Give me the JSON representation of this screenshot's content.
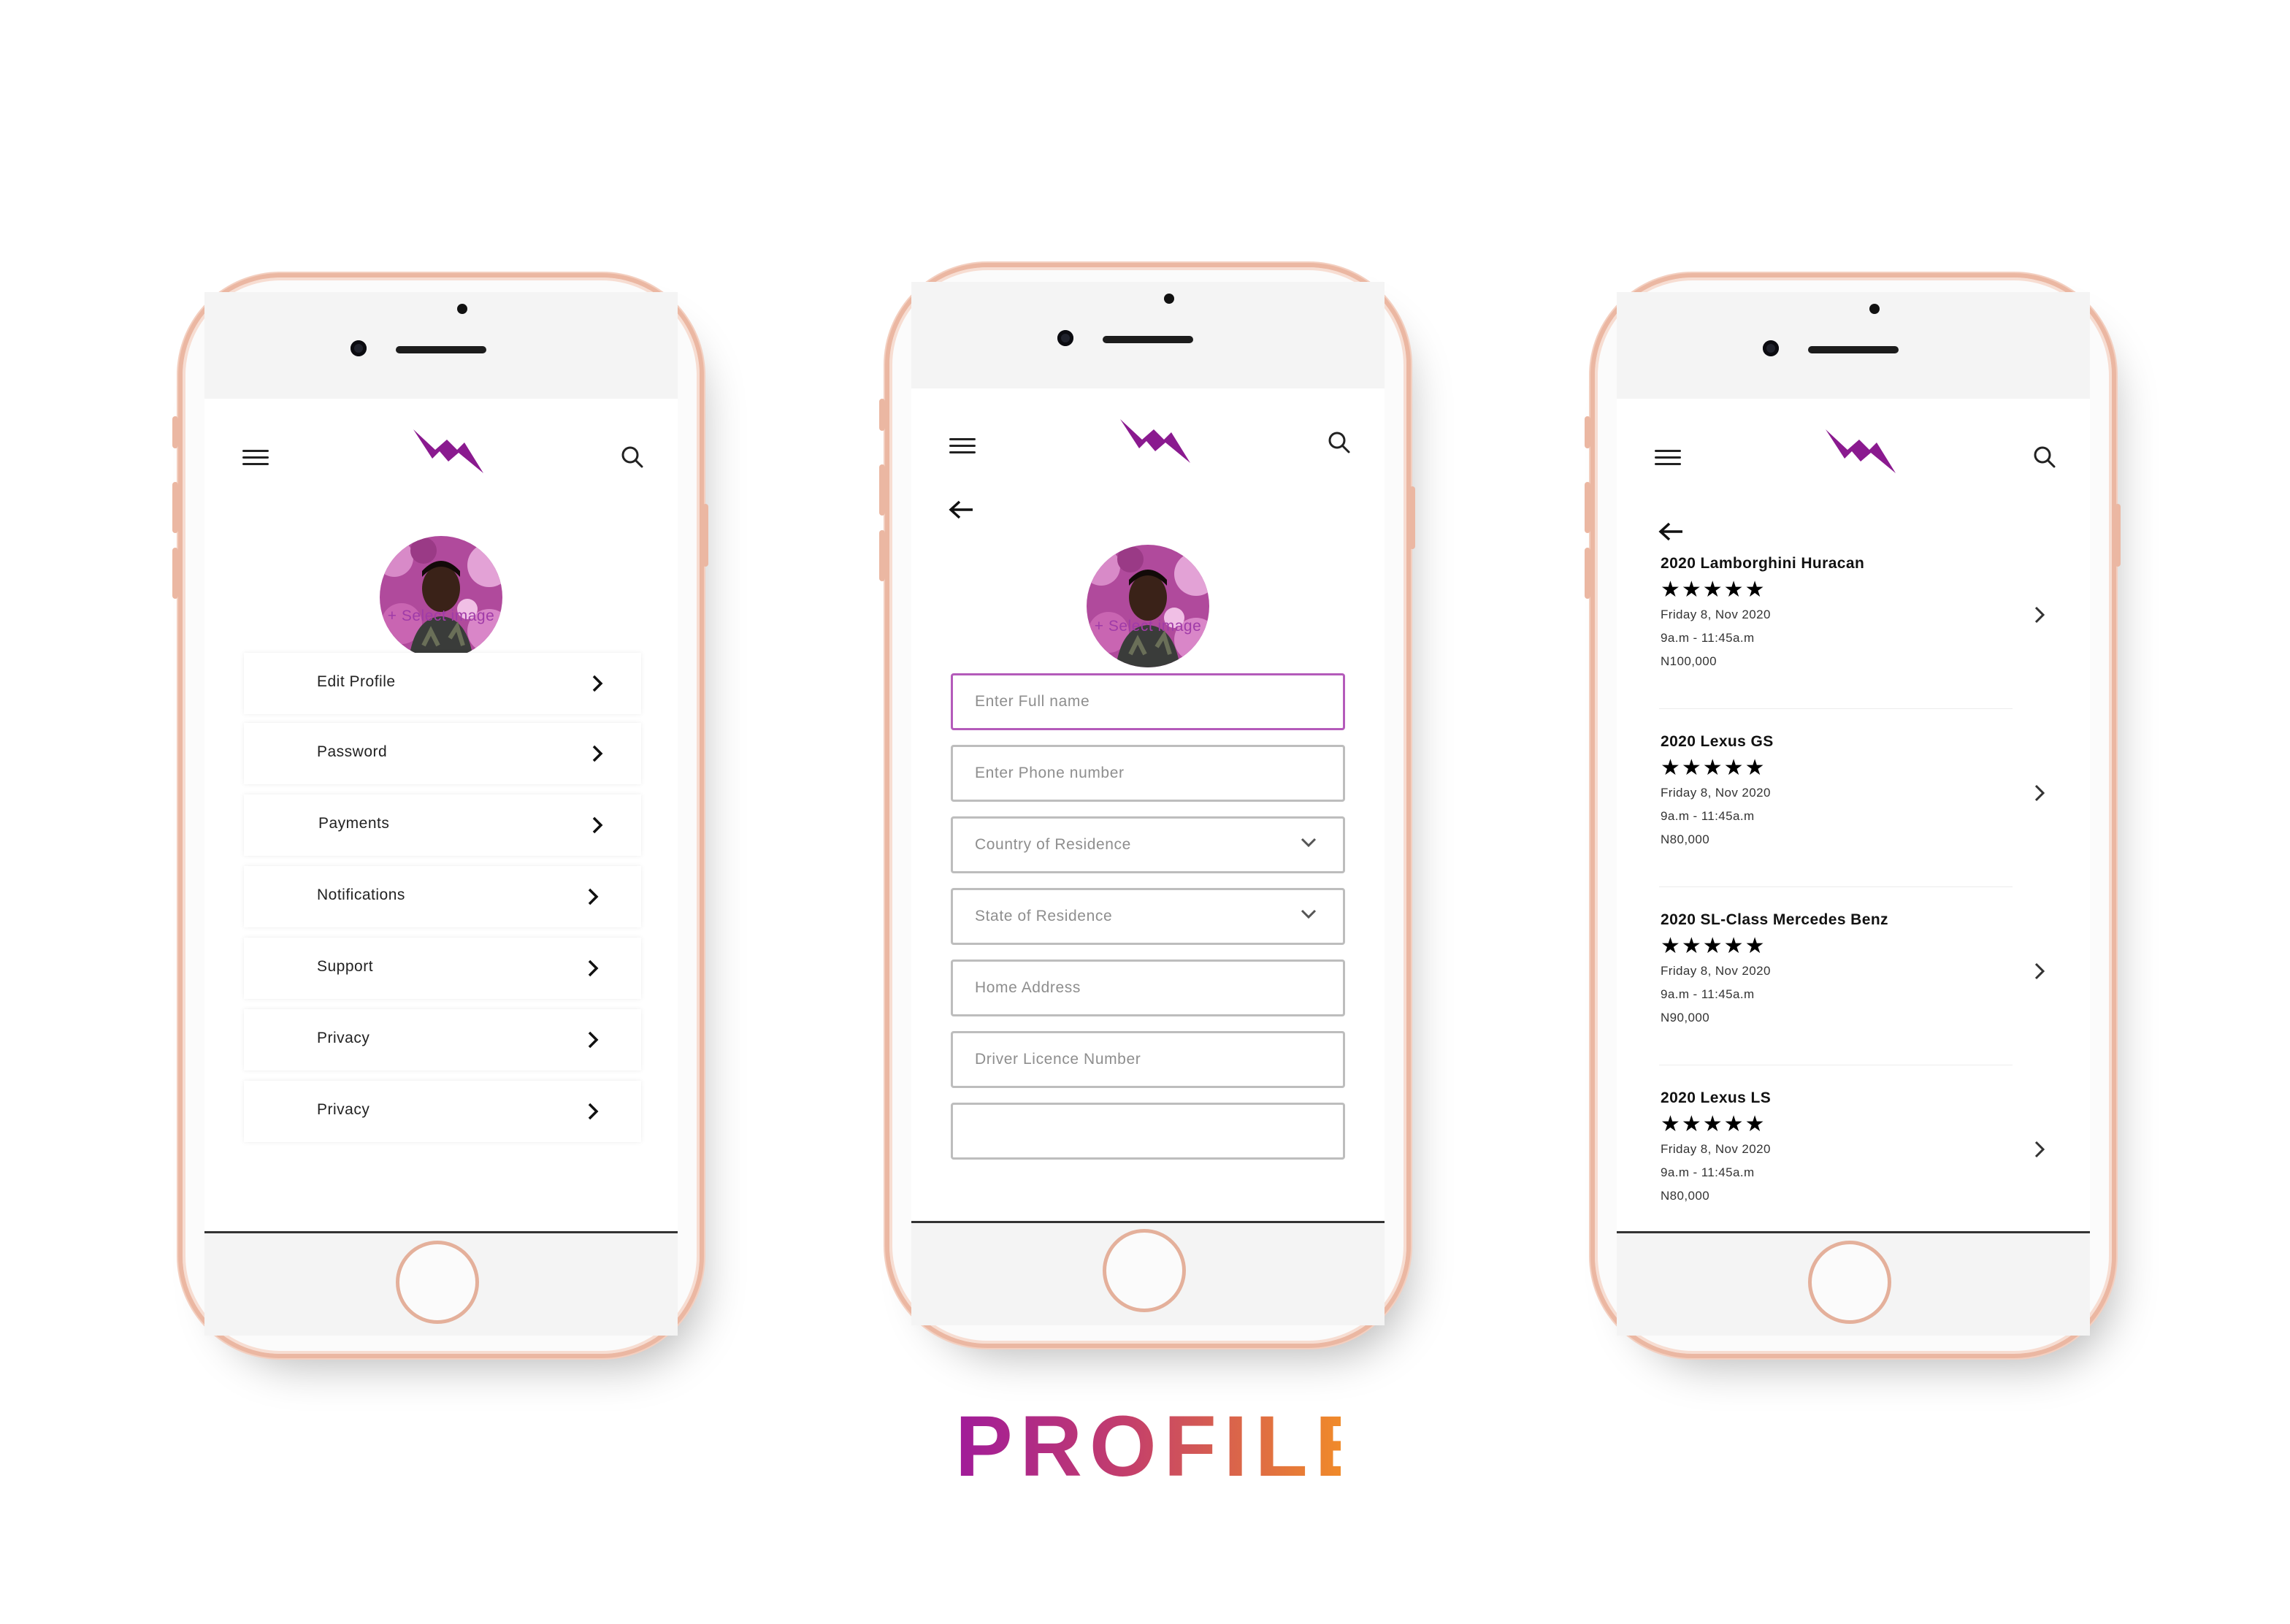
{
  "page_title": "PROFILE",
  "colors": {
    "brand_purple": "#8a1a8f",
    "accent_link": "#a03ba8",
    "title_gradient_start": "#a01b9a",
    "title_gradient_end": "#f08a2a"
  },
  "icons": [
    "hamburger-menu-icon",
    "brand-logo-icon",
    "search-icon",
    "back-arrow-icon",
    "chevron-right-icon",
    "chevron-down-icon",
    "star-icon"
  ],
  "screen1": {
    "select_image": "+ Select image",
    "menu": [
      {
        "label": "Edit Profile"
      },
      {
        "label": "Password"
      },
      {
        "label": "Payments"
      },
      {
        "label": "Notifications"
      },
      {
        "label": "Support"
      },
      {
        "label": "Privacy"
      },
      {
        "label": "Privacy"
      }
    ]
  },
  "screen2": {
    "select_image": "+ Select image",
    "fields": [
      {
        "placeholder": "Enter Full name"
      },
      {
        "placeholder": "Enter Phone number"
      },
      {
        "placeholder": "Country of Residence"
      },
      {
        "placeholder": "State of Residence"
      },
      {
        "placeholder": "Home Address"
      },
      {
        "placeholder": "Driver Licence Number"
      }
    ]
  },
  "screen3": {
    "bookings": [
      {
        "title": "2020 Lamborghini Huracan",
        "stars": "★★★★★",
        "rating": 5,
        "date": "Friday 8, Nov 2020",
        "time": "9a.m - 11:45a.m",
        "price": "N100,000"
      },
      {
        "title": "2020 Lexus GS",
        "stars": "★★★★★",
        "rating": 5,
        "date": "Friday 8, Nov 2020",
        "time": "9a.m - 11:45a.m",
        "price": "N80,000"
      },
      {
        "title": "2020 SL-Class Mercedes Benz",
        "stars": "★★★★★",
        "rating": 5,
        "date": "Friday 8, Nov 2020",
        "time": "9a.m - 11:45a.m",
        "price": "N90,000"
      },
      {
        "title": "2020 Lexus LS",
        "stars": "★★★★★",
        "rating": 5,
        "date": "Friday 8, Nov 2020",
        "time": "9a.m - 11:45a.m",
        "price": "N80,000"
      }
    ]
  }
}
